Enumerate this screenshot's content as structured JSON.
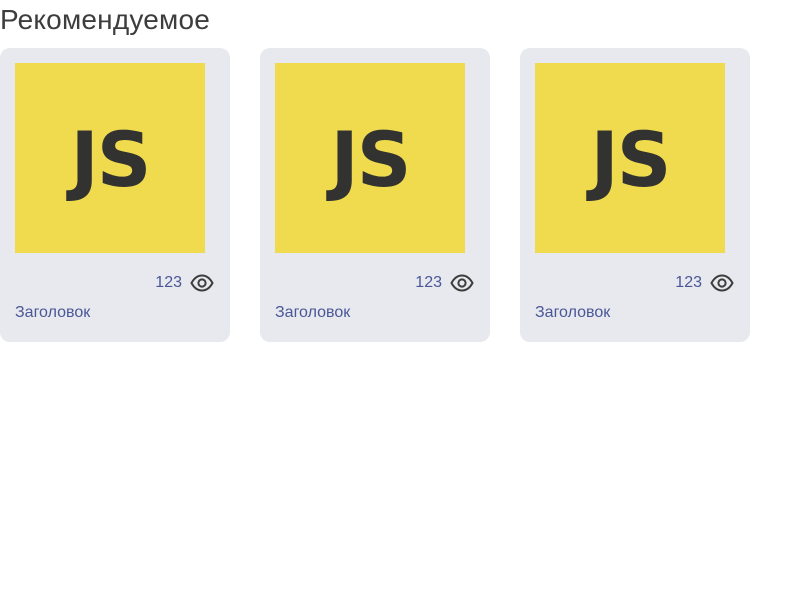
{
  "section": {
    "title": "Рекомендуемое"
  },
  "colors": {
    "thumb_bg": "#f0db4f",
    "thumb_fg": "#323330",
    "card_bg": "#e8e9ee",
    "accent_text": "#4a5797",
    "icon": "#3d3d3d"
  },
  "cards": [
    {
      "thumb_text": "JS",
      "views": "123",
      "views_icon": "eye-icon",
      "title": "Заголовок"
    },
    {
      "thumb_text": "JS",
      "views": "123",
      "views_icon": "eye-icon",
      "title": "Заголовок"
    },
    {
      "thumb_text": "JS",
      "views": "123",
      "views_icon": "eye-icon",
      "title": "Заголовок"
    }
  ]
}
